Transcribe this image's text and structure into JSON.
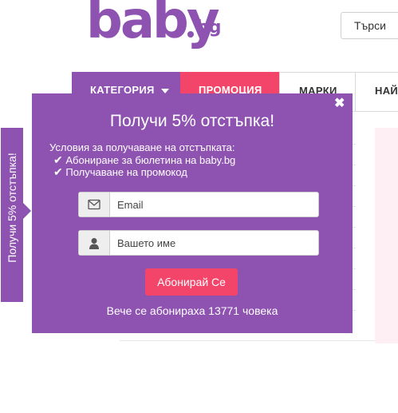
{
  "logo": {
    "main": "baby",
    "suffix": "bg"
  },
  "search": {
    "placeholder": "Търси"
  },
  "nav": {
    "category": "КАТЕГОРИЯ",
    "promo": "ПРОМОЦИЯ",
    "brands": "МАРКИ",
    "more": "НАЙ"
  },
  "side_tab": {
    "label": "Получи 5% отстъпка!"
  },
  "popup": {
    "close": "✖",
    "title": "Получи 5% отстъпка!",
    "conditions_heading": "Условия за получаване на отстъпката:",
    "conditions": [
      "Абониране за бюлетина на baby.bg",
      "Получаване на промокод"
    ],
    "email_placeholder": "Email",
    "name_placeholder": "Вашето име",
    "subscribe": "Абонирай Се",
    "subscribers": "Вече се абонираха 13771 човека"
  },
  "colors": {
    "brand_purple": "#8e52b1",
    "accent_pink": "#f3456a"
  },
  "icons": [
    "mail-icon",
    "user-icon",
    "close-icon",
    "chevron-down-icon",
    "checkmark-icon"
  ]
}
